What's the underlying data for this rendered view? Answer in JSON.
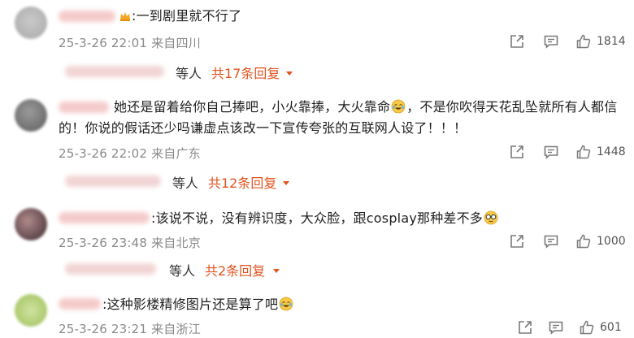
{
  "comments": [
    {
      "text_lines": [
        ":一到剧里就不行了"
      ],
      "date": "25-3-26 22:01",
      "location": "来自四川",
      "likes": "1814",
      "reply": {
        "etc": "等人",
        "link": "共17条回复"
      }
    },
    {
      "text_lines": [
        "她还是留着给你自己捧吧，小火靠捧，大火靠命",
        "，不是你吹得天花乱坠就所有人都信",
        "的！你说的假话还少吗谦虚点该改一下宣传夸张的互联网人设了！！！"
      ],
      "date": "25-3-26 22:02",
      "location": "来自广东",
      "likes": "1448",
      "reply": {
        "etc": "等人",
        "link": "共12条回复"
      }
    },
    {
      "text_lines": [
        ":该说不说，没有辨识度，大众脸，跟cosplay那种差不多"
      ],
      "date": "25-3-26 23:48",
      "location": "来自北京",
      "likes": "1000",
      "reply": {
        "etc": "等人",
        "link": "共2条回复"
      }
    },
    {
      "text_lines": ":这种影楼精修图片还是算了吧",
      "date": "25-3-26 23:21",
      "location": "来自浙江",
      "likes": "601"
    }
  ],
  "icons": [
    "share-icon",
    "comment-icon",
    "like-icon",
    "caret-down-icon",
    "laugh-cry-emoji",
    "glasses-emoji",
    "crown-badge-icon"
  ],
  "colors": {
    "reply_link": "#e2531f",
    "meta": "#8a8a8a",
    "icon": "#7a7a7a"
  }
}
